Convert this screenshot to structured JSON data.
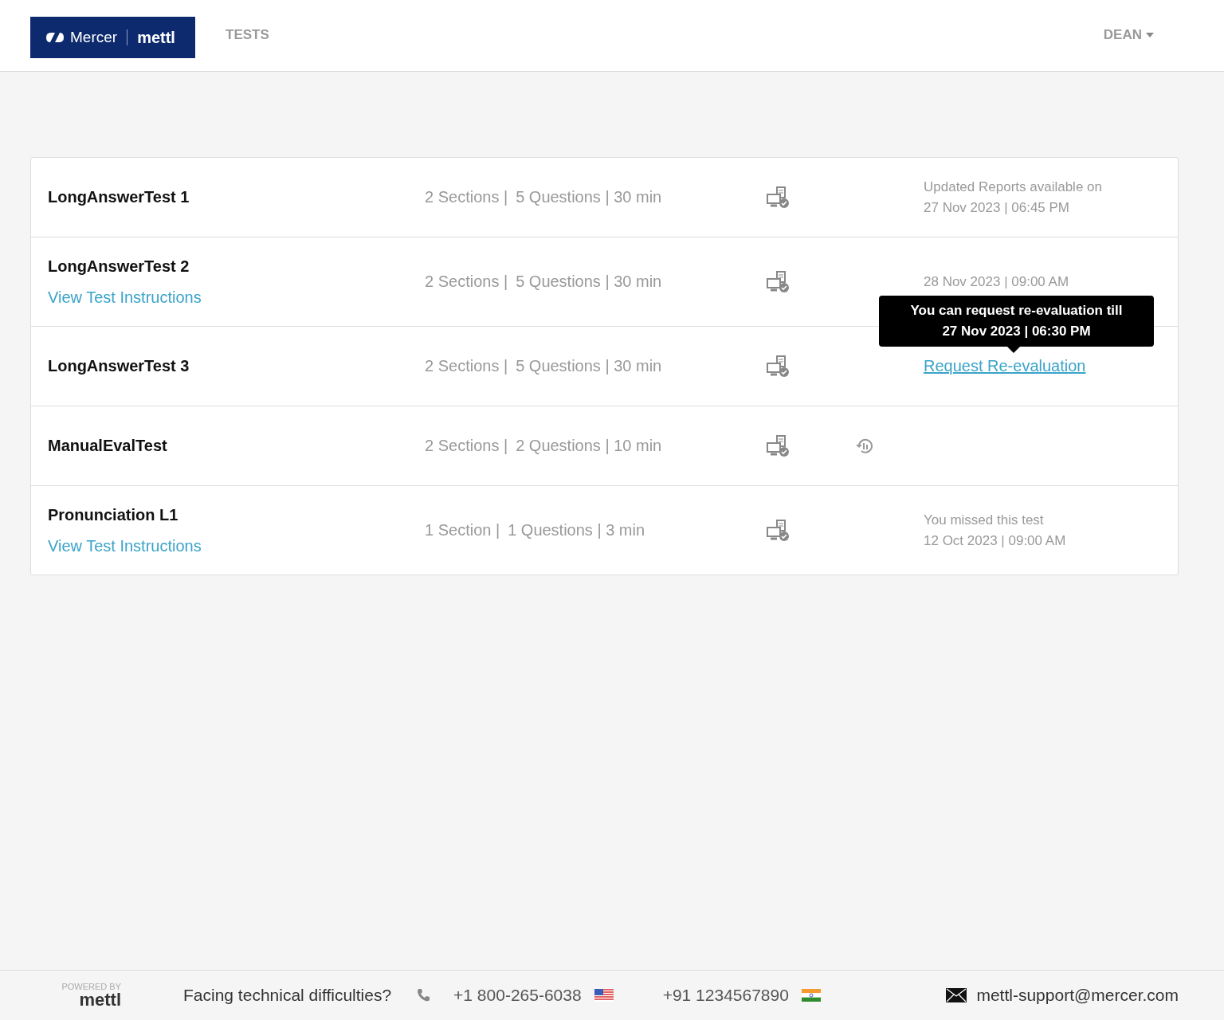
{
  "header": {
    "logo": {
      "brand": "Mercer",
      "product": "mettl"
    },
    "nav": [
      {
        "label": "TESTS",
        "selected": true
      }
    ],
    "user": {
      "name": "DEAN"
    }
  },
  "tests": [
    {
      "name": "LongAnswerTest 1",
      "sections": "2 Sections |",
      "details": "5 Questions | 30 min",
      "history": false,
      "status": {
        "kind": "text",
        "lines": [
          "Updated Reports available on",
          "27 Nov 2023 | 06:45 PM"
        ]
      }
    },
    {
      "name": "LongAnswerTest 2",
      "link": "View Test Instructions",
      "sections": "2 Sections |",
      "details": "5 Questions | 30 min",
      "history": false,
      "status": {
        "kind": "text",
        "lines": [
          "28 Nov 2023 | 09:00 AM"
        ]
      }
    },
    {
      "name": "LongAnswerTest 3",
      "sections": "2 Sections |",
      "details": "5 Questions | 30 min",
      "history": false,
      "status": {
        "kind": "link",
        "label": "Request Re-evaluation",
        "tooltip": [
          "You can request re-evaluation till",
          "27 Nov 2023 | 06:30 PM"
        ]
      }
    },
    {
      "name": "ManualEvalTest",
      "sections": "2 Sections |",
      "details": "2 Questions | 10 min",
      "history": true
    },
    {
      "name": "Pronunciation L1",
      "link": "View Test Instructions",
      "sections": "1 Section |",
      "details": "1 Questions | 3 min",
      "history": false,
      "status": {
        "kind": "text",
        "lines": [
          "You missed this test",
          "12 Oct 2023 | 09:00 AM"
        ]
      }
    }
  ],
  "footer": {
    "powered_by": "POWERED BY",
    "powered_logo": "mettl",
    "question": "Facing technical difficulties?",
    "phones": [
      {
        "number": "+1 800-265-6038",
        "kind": "us"
      },
      {
        "number": "+91 1234567890",
        "kind": "in"
      }
    ],
    "email": "mettl-support@mercer.com"
  }
}
